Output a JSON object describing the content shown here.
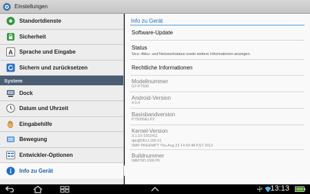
{
  "app": {
    "title": "Einstellungen"
  },
  "sidebar": {
    "items_top": [
      {
        "label": "Standortdienste",
        "icon": "location-icon"
      },
      {
        "label": "Sicherheit",
        "icon": "lock-icon"
      },
      {
        "label": "Sprache und Eingabe",
        "icon": "language-icon"
      },
      {
        "label": "Sichern und zurücksetzen",
        "icon": "backup-icon"
      }
    ],
    "section_header": "System",
    "items_system": [
      {
        "label": "Dock",
        "icon": "dock-icon"
      },
      {
        "label": "Datum und Uhrzeit",
        "icon": "clock-icon"
      },
      {
        "label": "Eingabehilfe",
        "icon": "hand-icon"
      },
      {
        "label": "Bewegung",
        "icon": "motion-icon"
      },
      {
        "label": "Entwickler-Optionen",
        "icon": "developer-icon"
      },
      {
        "label": "Info zu Gerät",
        "icon": "info-icon",
        "selected": true
      }
    ]
  },
  "content": {
    "title": "Info zu Gerät",
    "software_update": "Software-Update",
    "status": {
      "label": "Status",
      "sub": "Sicu- Akku- und Netzwerkstatus sowie weitere Informationen anzeigen."
    },
    "legal": "Rechtliche Informationen",
    "model": {
      "label": "Modellnummer",
      "value": "GT-P7500"
    },
    "android": {
      "label": "Android-Version",
      "value": "4.0.4"
    },
    "baseband": {
      "label": "Basisbandversion",
      "value": "P7500NELP2"
    },
    "kernel": {
      "label": "Kernel-Version",
      "line1": "3.1.10-1052411",
      "line2": "dpi@DELL156 #1",
      "line3": "SMP PREEMPT Thu Aug 23 14:43:48 KST 2012"
    },
    "build": {
      "label": "Buildnummer",
      "value": "IMM76D.XWLP6"
    }
  },
  "navbar": {
    "time": "13:13",
    "icons": [
      "back-icon",
      "home-icon",
      "recent-apps-icon",
      "up-arrow-icon",
      "usb-icon",
      "wifi-icon",
      "battery-icon"
    ]
  },
  "colors": {
    "accent": "#1b6fb8",
    "section_header": "#4b5d73"
  }
}
